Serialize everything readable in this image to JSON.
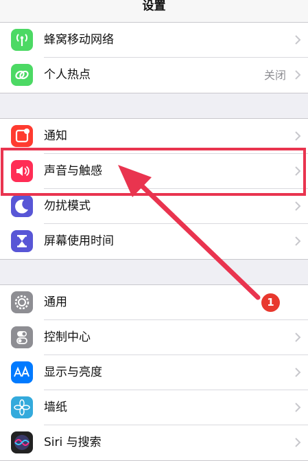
{
  "navbar": {
    "title": "设置"
  },
  "groups": [
    {
      "rows": [
        {
          "label": "蜂窝移动网络",
          "icon": "cellular-antenna-icon",
          "color": "#4cd964"
        },
        {
          "label": "个人热点",
          "value": "关闭",
          "icon": "hotspot-link-icon",
          "color": "#4cd964"
        }
      ]
    },
    {
      "rows": [
        {
          "label": "通知",
          "icon": "notifications-icon",
          "color": "#ff3b30"
        },
        {
          "label": "声音与触感",
          "icon": "speaker-icon",
          "color": "#ff2d55"
        },
        {
          "label": "勿扰模式",
          "icon": "moon-icon",
          "color": "#5856d6"
        },
        {
          "label": "屏幕使用时间",
          "icon": "hourglass-icon",
          "color": "#5856d6"
        }
      ]
    },
    {
      "rows": [
        {
          "label": "通用",
          "icon": "gear-icon",
          "color": "#8e8e93"
        },
        {
          "label": "控制中心",
          "icon": "toggle-icon",
          "color": "#8e8e93"
        },
        {
          "label": "显示与亮度",
          "icon": "text-size-icon",
          "color": "#007aff"
        },
        {
          "label": "墙纸",
          "icon": "flower-icon",
          "color": "#34aadc"
        },
        {
          "label": "Siri 与搜索",
          "icon": "siri-icon",
          "color": "#222222"
        }
      ]
    }
  ],
  "annotation": {
    "step_number": "1",
    "highlight_color": "#e9344f"
  }
}
